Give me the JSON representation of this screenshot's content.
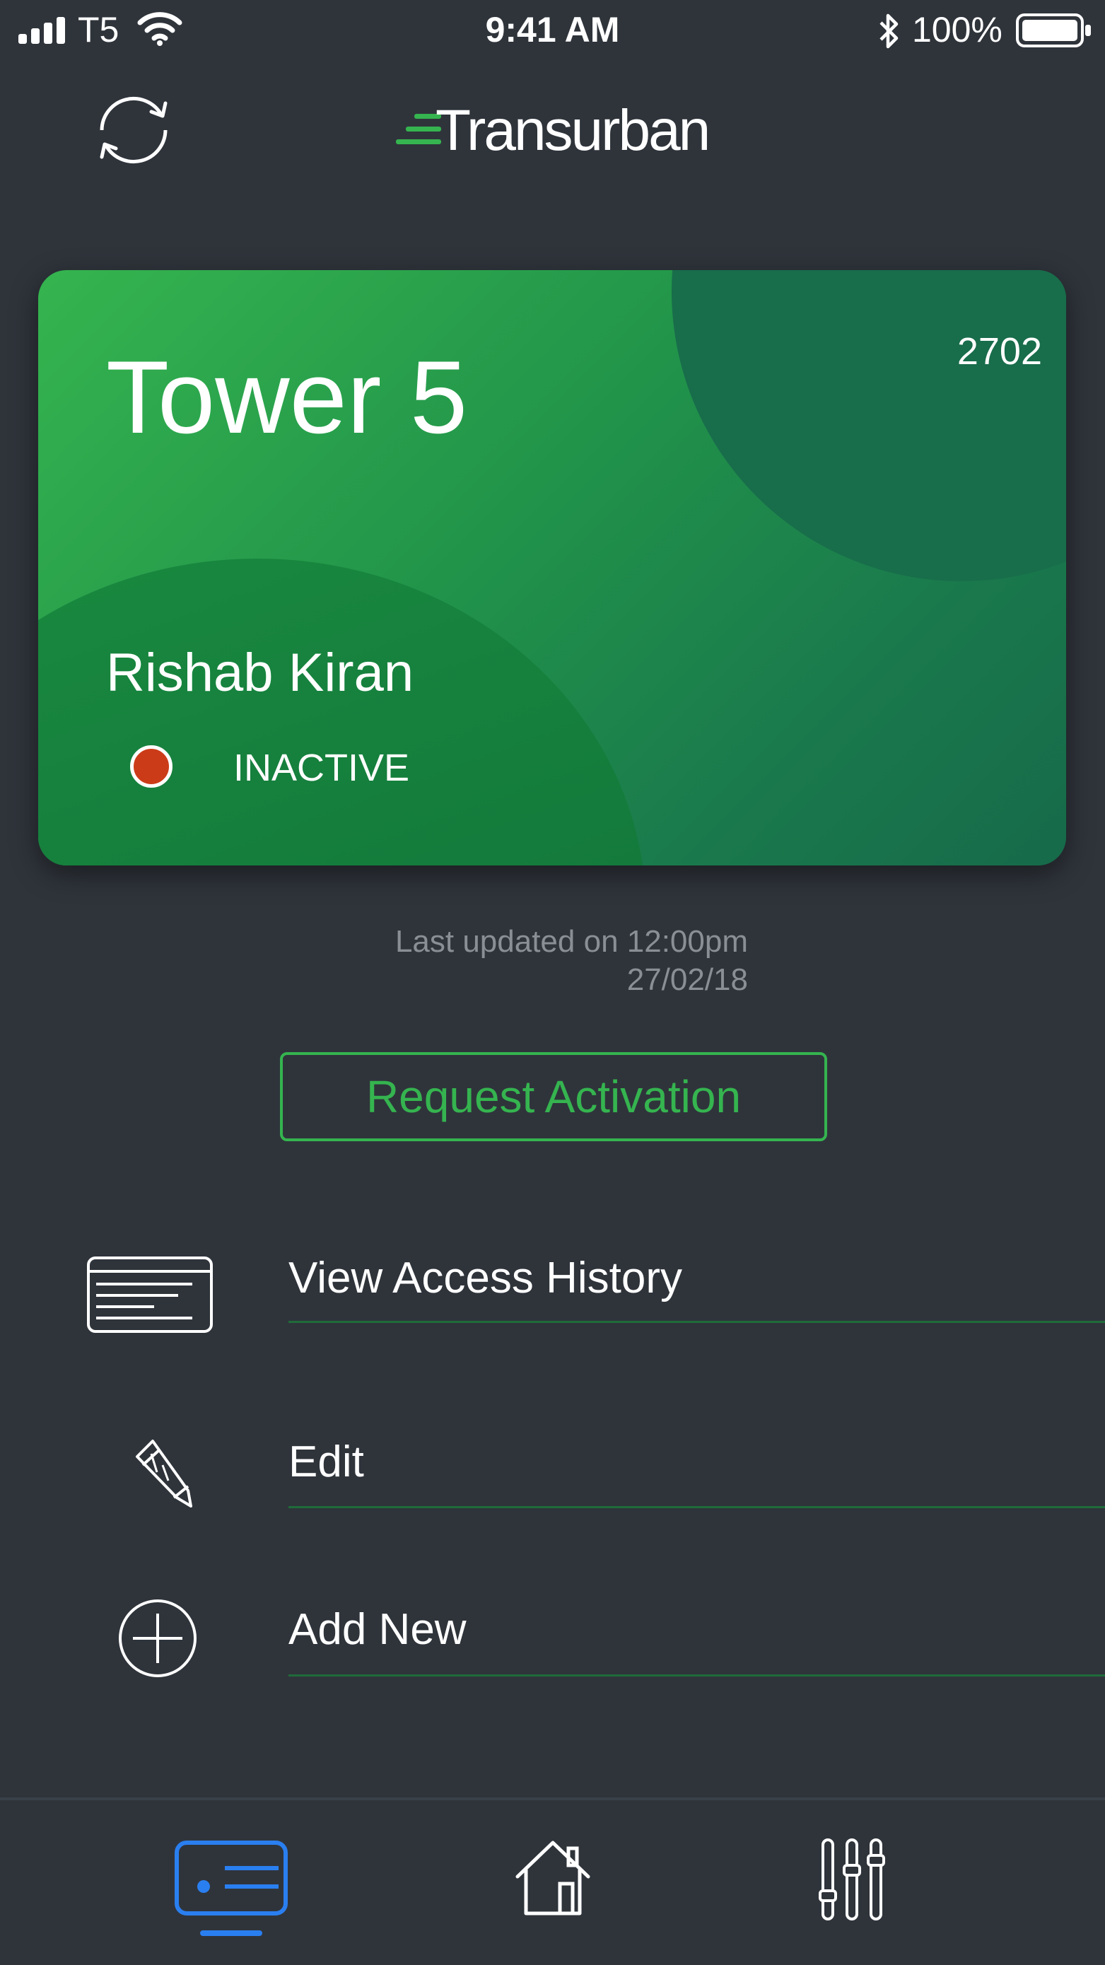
{
  "status_bar": {
    "carrier": "T5",
    "time": "9:41 AM",
    "battery": "100%"
  },
  "header": {
    "brand": "Transurban",
    "refresh_icon": "refresh-icon"
  },
  "card": {
    "title": "Tower 5",
    "number": "2702",
    "holder_name": "Rishab Kiran",
    "status": "INACTIVE",
    "status_color": "#cc3b18",
    "accent_color": "#35b44f"
  },
  "last_updated": {
    "line1": "Last updated on 12:00pm",
    "line2": "27/02/18"
  },
  "request_button": {
    "label": "Request Activation"
  },
  "menu": {
    "items": [
      {
        "label": "View Access History",
        "icon": "card-list-icon"
      },
      {
        "label": "Edit",
        "icon": "pencil-icon"
      },
      {
        "label": "Add New",
        "icon": "plus-circle-icon"
      }
    ]
  },
  "bottom_nav": {
    "items": [
      {
        "icon": "card-icon",
        "active": true
      },
      {
        "icon": "home-icon",
        "active": false
      },
      {
        "icon": "sliders-icon",
        "active": false
      }
    ],
    "active_color": "#2a7ff0"
  }
}
